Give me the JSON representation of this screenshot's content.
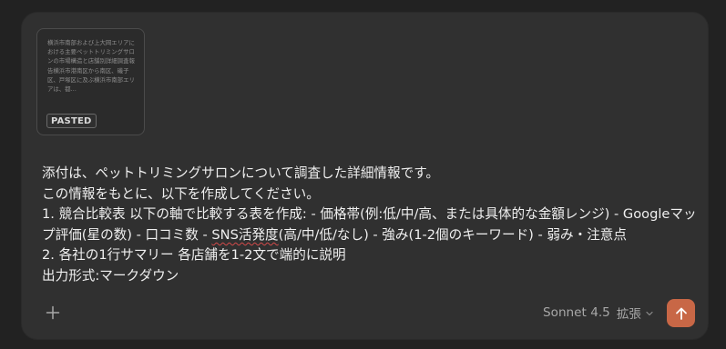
{
  "attachment": {
    "preview_text": "横浜市南部および上大岡エリアにおける主要ペットトリミングサロンの市場構造と店舗別詳細調査報告横浜市港南区から南区、磯子区、戸塚区に及ぶ横浜市南部エリアは、都…",
    "badge_label": "PASTED"
  },
  "message": {
    "line1": "添付は、ペットトリミングサロンについて調査した詳細情報です。",
    "line2": "この情報をもとに、以下を作成してください。",
    "line3": "1. 競合比較表 以下の軸で比較する表を作成: - 価格帯(例:低/中/高、または具体的な金額レンジ) - Googleマッ",
    "line4_before": "プ評価(星の数) - 口コミ数 - ",
    "line4_spell": "SNS活発度",
    "line4_after": "(高/中/低/なし) - 強み(1-2個のキーワード) - 弱み・注意点",
    "line5": "2. 各社の1行サマリー 各店舗を1-2文で端的に説明",
    "line6": "出力形式:マークダウン"
  },
  "toolbar": {
    "add_icon": "plus-icon",
    "model_name": "Sonnet 4.5",
    "model_mode": "拡張",
    "chevron_icon": "chevron-down-icon",
    "send_icon": "arrow-up-icon",
    "accent_color": "#c86746"
  }
}
